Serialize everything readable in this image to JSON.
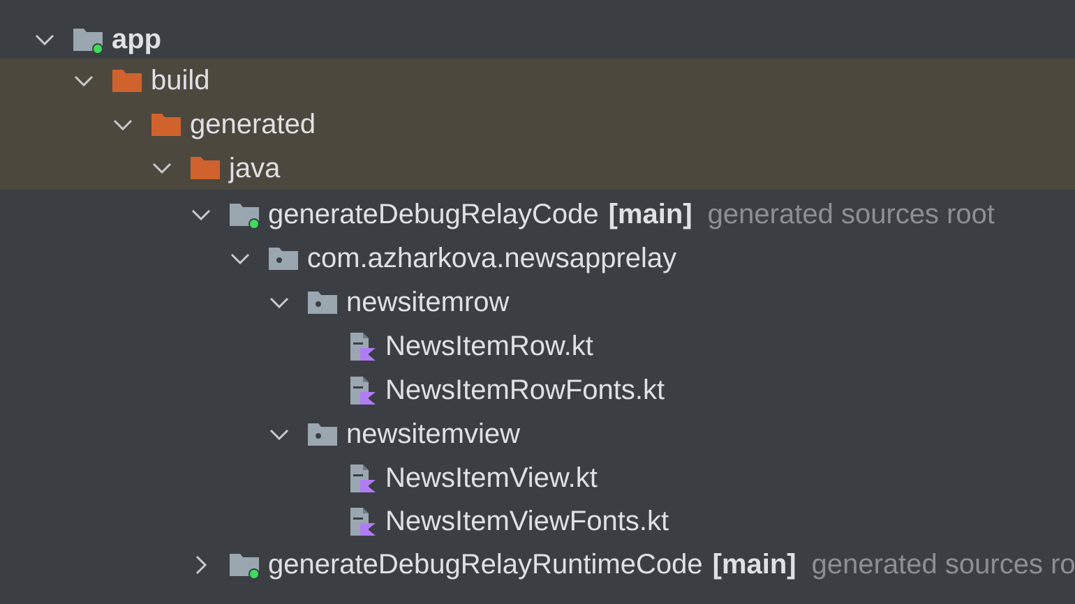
{
  "colors": {
    "background": "#3b3e42",
    "excluded_row_background": "#4c483e",
    "excluded_folder": "#d0632d",
    "source_folder": "#9aa7b0",
    "source_root_badge": "#3ddc5b",
    "kotlin_file_accent": "#b07cf4",
    "text": "#dfe1e5",
    "hint_text": "#8c8f94"
  },
  "tree": {
    "items": [
      {
        "label": "app",
        "tag": "",
        "hint": "",
        "icon": "module-folder-icon",
        "expanded": true
      },
      {
        "label": "build",
        "tag": "",
        "hint": "",
        "icon": "excluded-folder-icon",
        "expanded": true
      },
      {
        "label": "generated",
        "tag": "",
        "hint": "",
        "icon": "excluded-folder-icon",
        "expanded": true
      },
      {
        "label": "java",
        "tag": "",
        "hint": "",
        "icon": "excluded-folder-icon",
        "expanded": true
      },
      {
        "label": "generateDebugRelayCode",
        "tag": "[main]",
        "hint": "generated sources root",
        "icon": "generated-source-root-icon",
        "expanded": true
      },
      {
        "label": "com.azharkova.newsapprelay",
        "tag": "",
        "hint": "",
        "icon": "package-folder-icon",
        "expanded": true
      },
      {
        "label": "newsitemrow",
        "tag": "",
        "hint": "",
        "icon": "package-folder-icon",
        "expanded": true
      },
      {
        "label": "NewsItemRow.kt",
        "tag": "",
        "hint": "",
        "icon": "kotlin-file-icon",
        "expanded": null
      },
      {
        "label": "NewsItemRowFonts.kt",
        "tag": "",
        "hint": "",
        "icon": "kotlin-file-icon",
        "expanded": null
      },
      {
        "label": "newsitemview",
        "tag": "",
        "hint": "",
        "icon": "package-folder-icon",
        "expanded": true
      },
      {
        "label": "NewsItemView.kt",
        "tag": "",
        "hint": "",
        "icon": "kotlin-file-icon",
        "expanded": null
      },
      {
        "label": "NewsItemViewFonts.kt",
        "tag": "",
        "hint": "",
        "icon": "kotlin-file-icon",
        "expanded": null
      },
      {
        "label": "generateDebugRelayRuntimeCode",
        "tag": "[main]",
        "hint": "generated sources root",
        "icon": "generated-source-root-icon",
        "expanded": false
      }
    ]
  }
}
